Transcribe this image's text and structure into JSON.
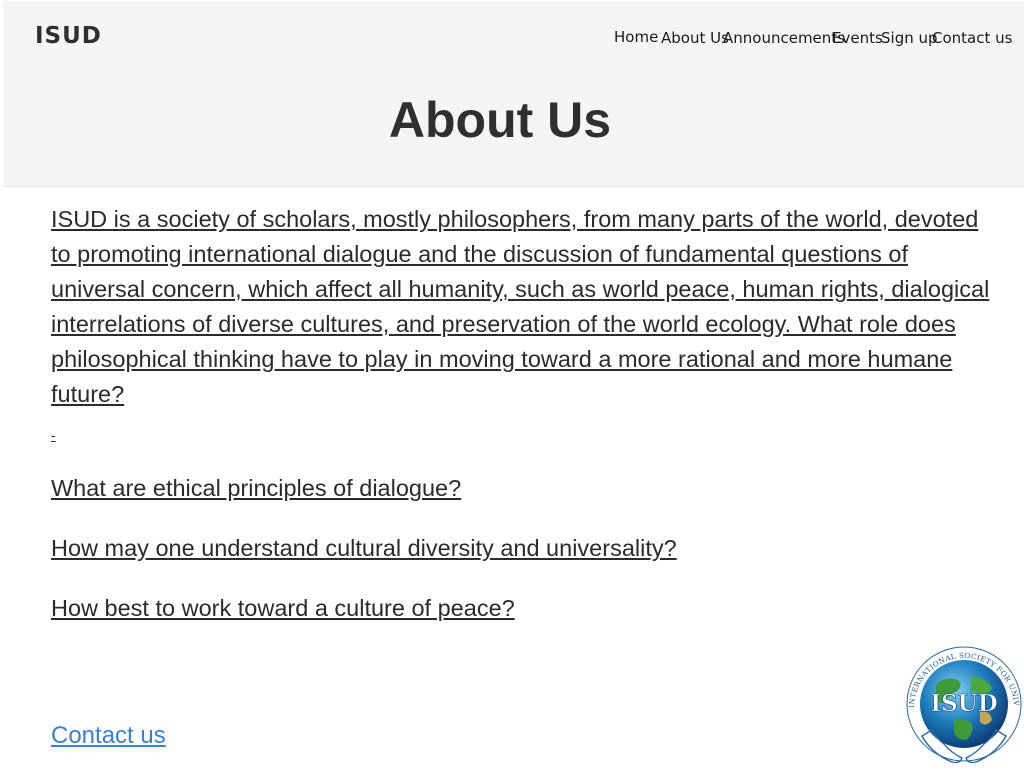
{
  "header": {
    "logo": "ISUD",
    "nav": [
      "Home",
      "About Us",
      "Announcements",
      "Events",
      "Sign up",
      "Contact us"
    ],
    "page_title": "About Us"
  },
  "main": {
    "intro": "ISUD is a society of scholars, mostly philosophers, from many parts of the world, devoted to promoting international dialogue and the discussion of fundamental questions of universal concern, which affect all humanity, such as world peace, human rights, dialogical interrelations of diverse cultures, and preservation of the world ecology.  What role does philosophical thinking have to play in moving toward a more rational and more humane future?",
    "dash": "-",
    "questions": [
      "What are ethical principles of dialogue?",
      "How may one understand cultural diversity and universality?",
      "How best to work toward a culture of peace?"
    ],
    "contact_link": "Contact us"
  },
  "emblem": {
    "center_text": "ISUD",
    "ring_text": "INTERNATIONAL SOCIETY FOR UNIVERSAL DIALOGUE",
    "icon": "globe-emblem-icon"
  },
  "colors": {
    "header_bg": "#f5f5f5",
    "text": "#2b2b2b",
    "link": "#3b7fd6"
  }
}
